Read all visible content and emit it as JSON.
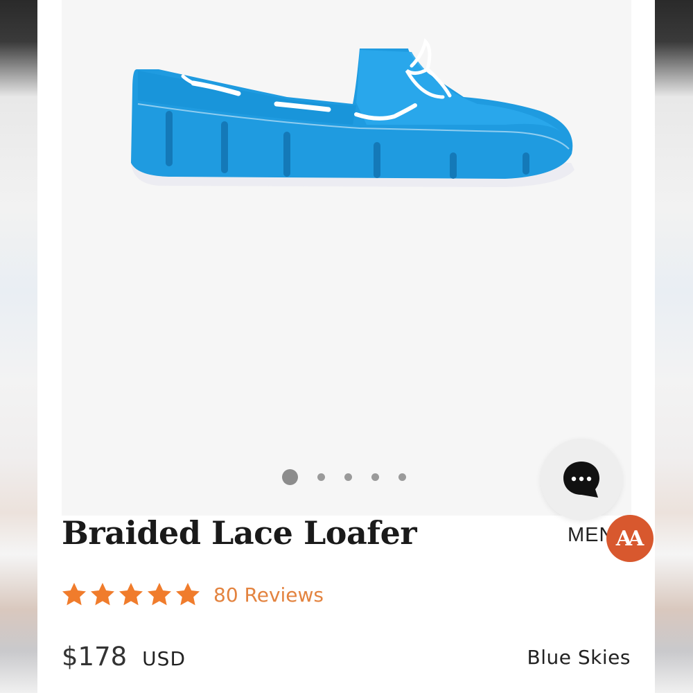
{
  "product": {
    "title": "Braided Lace Loafer",
    "rating": 5,
    "rating_max": 5,
    "reviews_label": "80 Reviews",
    "price": "$178",
    "currency": "USD",
    "color_name": "Blue Skies",
    "image_color": "#1f9be0"
  },
  "gallery": {
    "slide_count": 5,
    "active_slide": 1
  },
  "header_overlay": {
    "menu_label": "MENU",
    "accessibility_badge": "AA"
  },
  "icons": {
    "chat": "chat-bubble-ellipsis-icon",
    "star": "star-icon"
  },
  "colors": {
    "star": "#f07c2c",
    "reviews_link": "#e3833f",
    "badge": "#d8582e",
    "shoe_blue": "#1f9be0"
  }
}
